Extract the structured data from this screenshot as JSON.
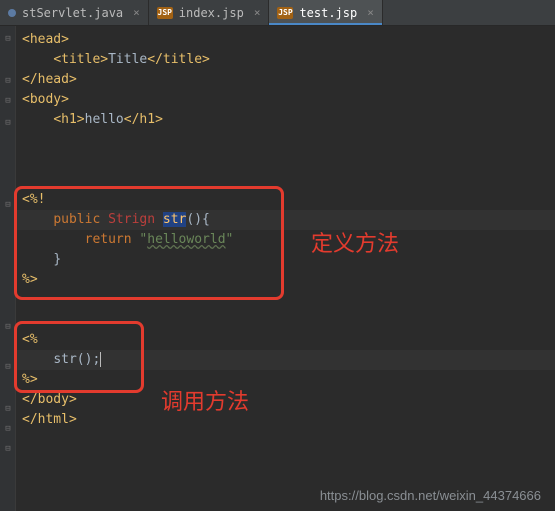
{
  "tabs": [
    {
      "icon": "java",
      "label": "stServlet.java",
      "close": "×"
    },
    {
      "icon": "jsp",
      "iconText": "JSP",
      "label": "index.jsp",
      "close": "×"
    },
    {
      "icon": "jsp",
      "iconText": "JSP",
      "label": "test.jsp",
      "close": "×"
    }
  ],
  "code": {
    "l1": {
      "open": "<",
      "tag": "head",
      "close": ">"
    },
    "l2": {
      "a": "<",
      "b": "title",
      "c": ">",
      "d": "Title",
      "e": "</",
      "f": "title",
      "g": ">"
    },
    "l3": {
      "a": "</",
      "b": "head",
      "c": ">"
    },
    "l4": {
      "a": "<",
      "b": "body",
      "c": ">"
    },
    "l5": {
      "a": "<",
      "b": "h1",
      "c": ">",
      "d": "hello",
      "e": "</",
      "f": "h1",
      "g": ">"
    },
    "l6": "",
    "l7": {
      "open": "<%!"
    },
    "l8": {
      "kw": "public ",
      "err": "Strign ",
      "method": "str",
      "rest": "(){"
    },
    "l9": {
      "kw": "return ",
      "q1": "\"",
      "str": "helloworld",
      "q2": "\""
    },
    "l10": {
      "brace": "}"
    },
    "l11": {
      "close": "%>"
    },
    "l12": "",
    "l13": {
      "open": "<%"
    },
    "l14": {
      "call": "str();"
    },
    "l15": {
      "close": "%>"
    },
    "l16": {
      "a": "</",
      "b": "body",
      "c": ">"
    },
    "l17": {
      "a": "</",
      "b": "html",
      "c": ">"
    }
  },
  "annotations": {
    "define": "定义方法",
    "call": "调用方法"
  },
  "watermark": "https://blog.csdn.net/weixin_44374666"
}
